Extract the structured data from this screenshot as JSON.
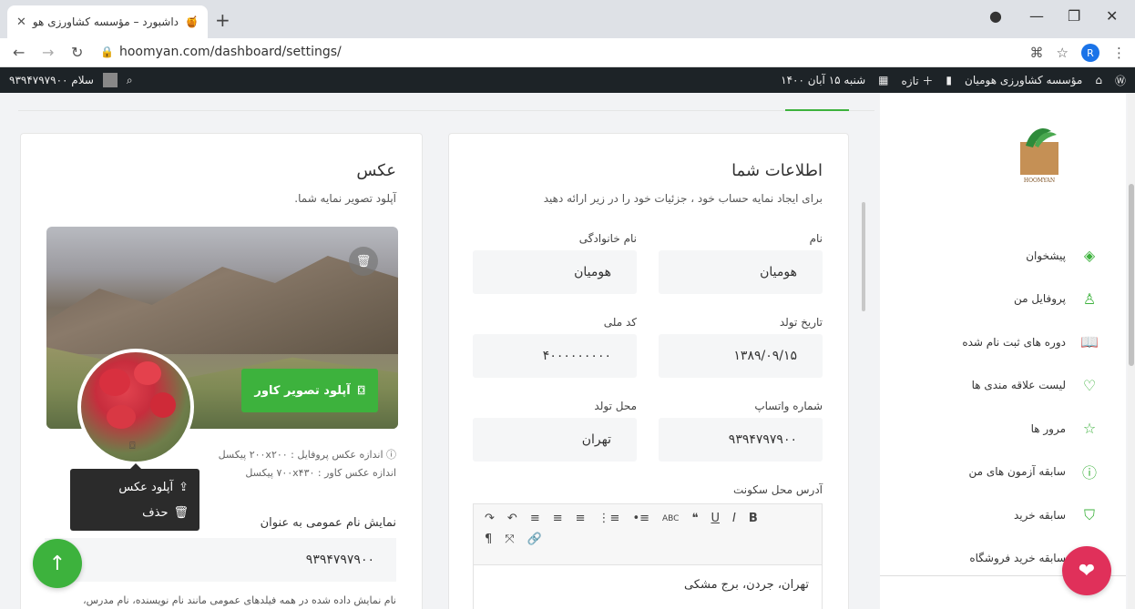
{
  "browser": {
    "tab_title": "داشبورد – مؤسسه کشاورزی هومیان",
    "url": "hoomyan.com/dashboard/settings/",
    "profile_initial": "R"
  },
  "wp_bar": {
    "site_name": "مؤسسه کشاورزی هومیان",
    "new_label": "تازه",
    "date": "شنبه ۱۵ آبان ۱۴۰۰",
    "greeting": "سلام ۹۳۹۴۷۹۷۹۰۰"
  },
  "sidebar": {
    "logo_text": "HOOMYAN",
    "items": [
      {
        "label": "پیشخوان",
        "icon": "layers-icon"
      },
      {
        "label": "پروفایل من",
        "icon": "user-icon"
      },
      {
        "label": "دوره های ثبت نام شده",
        "icon": "book-open-icon"
      },
      {
        "label": "لیست علاقه مندی ها",
        "icon": "heart-icon"
      },
      {
        "label": "مرور ها",
        "icon": "star-icon"
      },
      {
        "label": "سابقه آزمون های من",
        "icon": "help-circle-icon"
      },
      {
        "label": "سابقه خرید",
        "icon": "cart-icon"
      },
      {
        "label": "سابقه خرید فروشگاه",
        "icon": "bag-icon"
      }
    ]
  },
  "info_card": {
    "title": "اطلاعات شما",
    "subtitle": "برای ایجاد نمایه حساب خود ، جزئیات خود را در زیر ارائه دهید",
    "fields": {
      "first_name": {
        "label": "نام",
        "value": "هومیان"
      },
      "last_name": {
        "label": "نام خانوادگی",
        "value": "هومیان"
      },
      "birth_date": {
        "label": "تاریخ تولد",
        "value": "۱۳۸۹/۰۹/۱۵"
      },
      "national_id": {
        "label": "کد ملی",
        "value": "۴۰۰۰۰۰۰۰۰۰"
      },
      "whatsapp": {
        "label": "شماره واتساپ",
        "value": "۹۳۹۴۷۹۷۹۰۰"
      },
      "birth_place": {
        "label": "محل تولد",
        "value": "تهران"
      }
    },
    "address_label": "آدرس محل سکونت",
    "address_value": "تهران، جردن، برج مشکی"
  },
  "photo_card": {
    "title": "عکس",
    "subtitle": "آپلود تصویر نمایه شما.",
    "upload_cover_label": "آپلود تصویر کاور",
    "profile_size": "اندازه عکس پروفایل : ۲۰۰x۲۰۰ پیکسل",
    "cover_size": "اندازه عکس کاور : ۷۰۰x۴۳۰ پیکسل",
    "popover_upload": "آپلود عکس",
    "popover_delete": "حذف",
    "public_name_label": "نمایش نام عمومی به عنوان",
    "public_name_value": "۹۳۹۴۷۹۷۹۰۰",
    "public_hint": "نام نمایش داده شده در همه فیلدهای عمومی مانند نام نویسنده، نام مدرس،"
  }
}
